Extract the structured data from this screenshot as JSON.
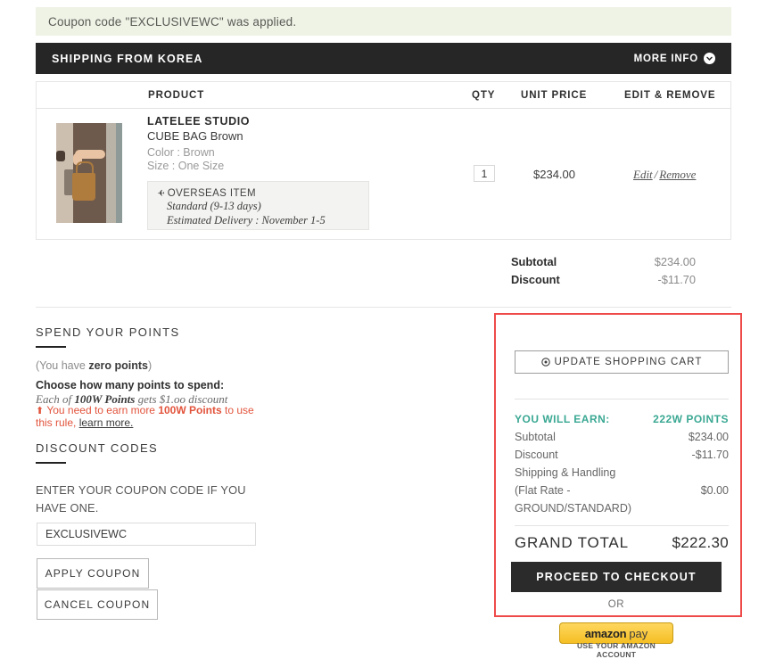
{
  "notice": {
    "message": "Coupon code \"EXCLUSIVEWC\" was applied."
  },
  "shipping_banner": {
    "title": "SHIPPING FROM KOREA",
    "more_info_label": "MORE INFO",
    "more_info_icon": "chevron-down-icon"
  },
  "cart_table": {
    "headers": {
      "product": "PRODUCT",
      "qty": "QTY",
      "unit_price": "UNIT PRICE",
      "edit_remove": "EDIT & REMOVE"
    },
    "item": {
      "brand": "LATELEE STUDIO",
      "name": "CUBE BAG Brown",
      "option_color": "Color : Brown",
      "option_size": "Size : One Size",
      "overseas_icon": "airplane-icon",
      "overseas_title": "OVERSEAS ITEM",
      "overseas_standard": "Standard (9-13 days)",
      "overseas_delivery": "Estimated Delivery : November 1-5",
      "qty_value": "1",
      "unit_price": "$234.00",
      "edit_label": "Edit",
      "separator": "/",
      "remove_label": "Remove"
    }
  },
  "cart_totals": {
    "subtotal_label": "Subtotal",
    "subtotal_value": "$234.00",
    "discount_label": "Discount",
    "discount_value": "-$11.70"
  },
  "points_section": {
    "title": "SPEND YOUR POINTS",
    "balance_prefix": "(You have ",
    "balance_strong": "zero points",
    "balance_suffix": ")",
    "choose_label": "Choose how many points to spend:",
    "rule_prefix": "Each of ",
    "rule_strong": "100W Points",
    "rule_suffix": " gets $1.oo discount",
    "warn_arrow": "⬆",
    "warn_prefix": " You need to earn more ",
    "warn_strong": "100W Points",
    "warn_suffix": " to use this rule, ",
    "warn_link": "learn more."
  },
  "discount_section": {
    "title": "DISCOUNT CODES",
    "help_text": "ENTER YOUR COUPON CODE IF YOU HAVE ONE.",
    "input_value": "EXCLUSIVEWC",
    "input_placeholder": "Enter coupon code",
    "apply_label": "APPLY COUPON",
    "cancel_label": "CANCEL COUPON"
  },
  "summary_panel": {
    "update_icon": "refresh-icon",
    "update_label": "UPDATE SHOPPING CART",
    "earn_label": "YOU WILL EARN:",
    "earn_value": "222W POINTS",
    "rows": [
      {
        "label": "Subtotal",
        "value": "$234.00"
      },
      {
        "label": "Discount",
        "value": "-$11.70"
      },
      {
        "label": "Shipping & Handling",
        "value": ""
      },
      {
        "label": "(Flat Rate -",
        "value": "$0.00"
      },
      {
        "label": "GROUND/STANDARD)",
        "value": ""
      }
    ],
    "grand_total_label": "GRAND TOTAL",
    "grand_total_value": "$222.30",
    "checkout_label": "PROCEED TO CHECKOUT",
    "or_label": "OR",
    "amazon_word": "amazon",
    "amazon_pay": "pay",
    "amazon_sub": "USE YOUR AMAZON ACCOUNT"
  },
  "colors": {
    "notice_bg": "#eef3e6",
    "banner_bg": "#262626",
    "accent_teal": "#3aa893",
    "warning_red": "#e2543c",
    "highlight_red": "#ef4a4a",
    "amazon_yellow": "#f5bf24"
  }
}
